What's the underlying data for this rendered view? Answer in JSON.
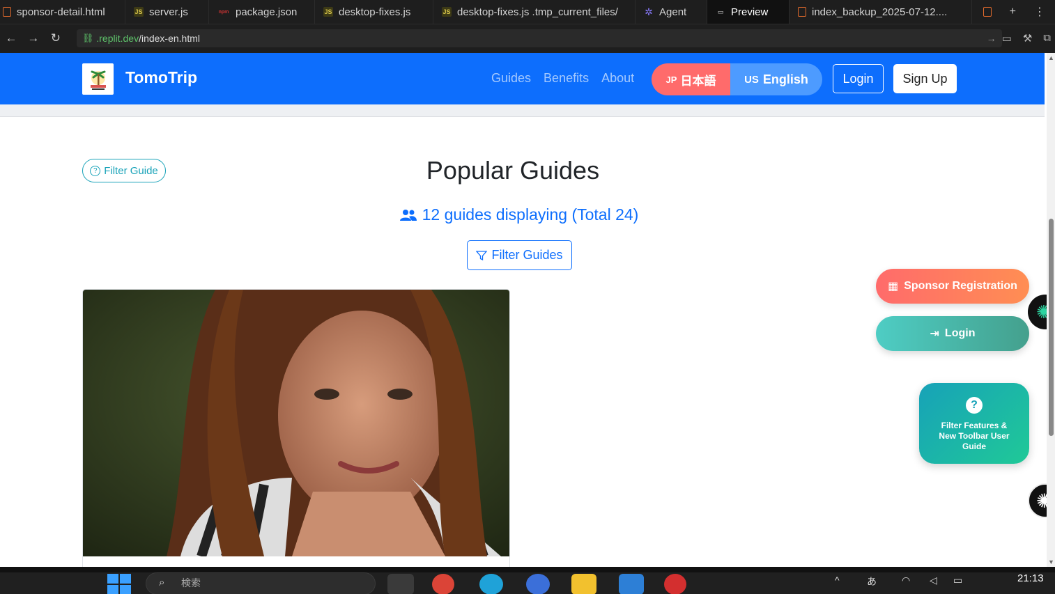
{
  "ide_tabs": [
    {
      "label": "sponsor-detail.html",
      "icon": "html-file-icon"
    },
    {
      "label": "server.js",
      "icon": "js-file-icon"
    },
    {
      "label": "package.json",
      "icon": "npm-file-icon"
    },
    {
      "label": "desktop-fixes.js",
      "icon": "js-file-icon"
    },
    {
      "label": "desktop-fixes.js .tmp_current_files/",
      "icon": "js-file-icon"
    },
    {
      "label": "Agent",
      "icon": "agent-icon"
    },
    {
      "label": "Preview",
      "icon": "preview-monitor-icon",
      "active": true
    },
    {
      "label": "index_backup_2025-07-12....",
      "icon": "html-file-icon"
    }
  ],
  "address": {
    "host": ".replit.dev",
    "path": "/index-en.html"
  },
  "navbar": {
    "brand": "TomoTrip",
    "links": [
      "Guides",
      "Benefits",
      "About"
    ],
    "lang_jp_code": "JP",
    "lang_jp_label": "日本語",
    "lang_en_code": "US",
    "lang_en_label": "English",
    "login": "Login",
    "signup": "Sign Up"
  },
  "main": {
    "filter_guide_pill": "Filter Guide",
    "title": "Popular Guides",
    "guide_count": "12 guides displaying (Total 24)",
    "filter_button": "Filter Guides"
  },
  "floating": {
    "sponsor": "Sponsor Registration",
    "login": "Login",
    "help": "Filter Features & New Toolbar User Guide"
  },
  "taskbar": {
    "search_placeholder": "検索",
    "clock": "21:13"
  },
  "colors": {
    "primary": "#0d6efd",
    "sponsor_start": "#ff6b6b",
    "login_start": "#4ecdc4",
    "help_start": "#17a2b8"
  }
}
